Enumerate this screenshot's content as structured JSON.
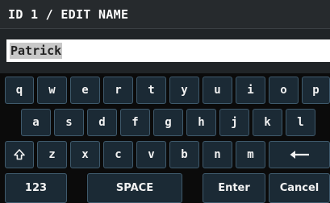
{
  "header": {
    "title": "ID 1 / EDIT NAME"
  },
  "name_field": {
    "value": "Patrick"
  },
  "keyboard": {
    "row1": [
      "q",
      "w",
      "e",
      "r",
      "t",
      "y",
      "u",
      "i",
      "o",
      "p"
    ],
    "row2": [
      "a",
      "s",
      "d",
      "f",
      "g",
      "h",
      "j",
      "k",
      "l"
    ],
    "row3": [
      "z",
      "x",
      "c",
      "v",
      "b",
      "n",
      "m"
    ],
    "shift_icon": "shift-arrow-up-icon",
    "backspace_icon": "left-arrow-icon",
    "numbers_label": "123",
    "space_label": "SPACE",
    "enter_label": "Enter",
    "cancel_label": "Cancel"
  },
  "colors": {
    "header_bg": "#262a2d",
    "key_bg": "#1b2a35",
    "key_border": "#3f5a6c",
    "field_bg": "#ffffff"
  }
}
